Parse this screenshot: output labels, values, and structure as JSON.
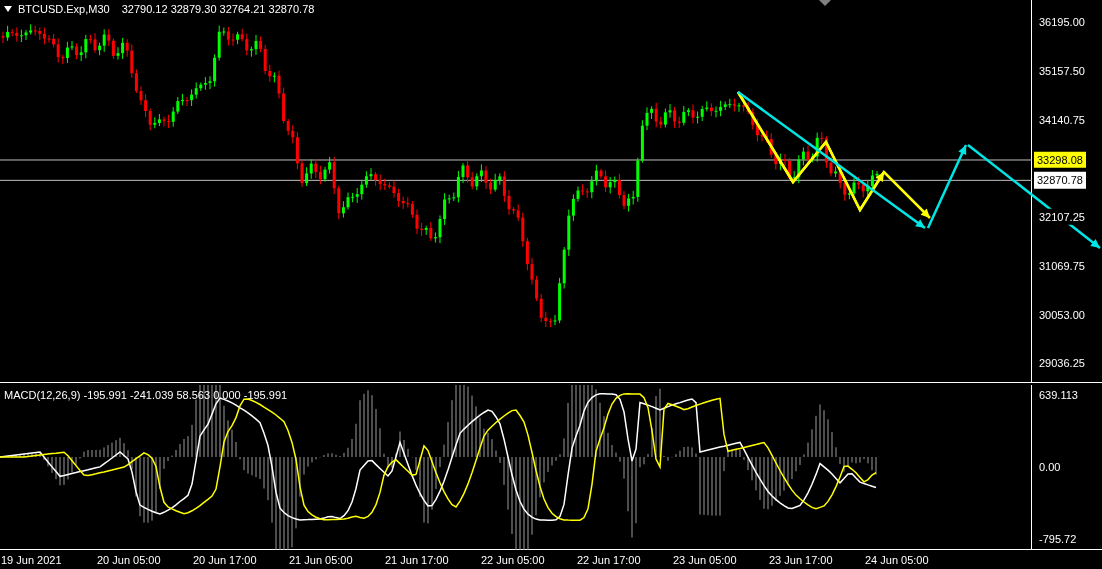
{
  "header": {
    "symbol": "BTCUSD.Exp,M30",
    "ohlc": "32790.12 32879.30 32764.21 32870.78"
  },
  "price_axis": [
    "36195.00",
    "35157.50",
    "34140.75",
    "32107.25",
    "31069.75",
    "30053.00",
    "29036.25"
  ],
  "price_tags": [
    {
      "text": "33298.08",
      "kind": "level"
    },
    {
      "text": "32870.78",
      "kind": "bid"
    }
  ],
  "macd": {
    "header": "MACD(12,26,9) -195.991 -241.039 58.563 0.000 -195.991",
    "axis": [
      "639.113",
      "0.00",
      "-795.72"
    ]
  },
  "time_axis": [
    "19 Jun 2021",
    "20 Jun 05:00",
    "20 Jun 17:00",
    "21 Jun 05:00",
    "21 Jun 17:00",
    "22 Jun 05:00",
    "22 Jun 17:00",
    "23 Jun 05:00",
    "23 Jun 17:00",
    "24 Jun 05:00"
  ]
}
